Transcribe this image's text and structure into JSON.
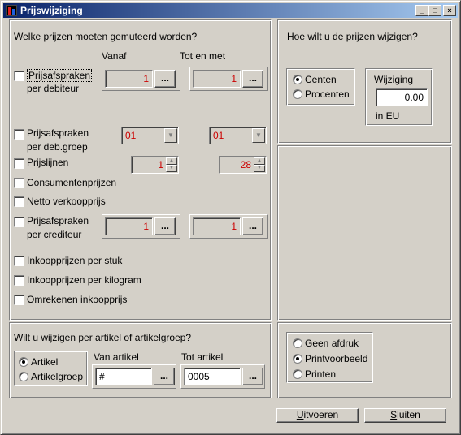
{
  "window": {
    "title": "Prijswijziging",
    "minimize_glyph": "_",
    "maximize_glyph": "□",
    "close_glyph": "×"
  },
  "prices_panel": {
    "heading": "Welke prijzen moeten gemuteerd worden?",
    "col_from": "Vanaf",
    "col_to": "Tot en met",
    "debtor_agreements": {
      "label_line1": "Prijsafspraken",
      "label_line2": "per debiteur",
      "checked": false,
      "from": "1",
      "to": "1",
      "lookup_glyph": "..."
    },
    "group_agreements": {
      "label_line1": "Prijsafspraken",
      "label_line2": "per deb.groep",
      "checked": false,
      "from": "01",
      "to": "01"
    },
    "price_lines": {
      "label": "Prijslijnen",
      "checked": false,
      "from": "1",
      "to": "28"
    },
    "consumer_prices": {
      "label": "Consumentenprijzen",
      "checked": false
    },
    "net_price": {
      "label": "Netto verkoopprijs",
      "checked": false
    },
    "creditor_agreements": {
      "label_line1": "Prijsafspraken",
      "label_line2": "per crediteur",
      "checked": false,
      "from": "1",
      "to": "1"
    },
    "purchase_per_piece": {
      "label": "Inkoopprijzen per stuk",
      "checked": false
    },
    "purchase_per_kg": {
      "label": "Inkoopprijzen per kilogram",
      "checked": false
    },
    "convert_purchase": {
      "label": "Omrekenen inkoopprijs",
      "checked": false
    }
  },
  "change_panel": {
    "heading": "Hoe wilt u de prijzen wijzigen?",
    "radio_cents": "Centen",
    "radio_percent": "Procenten",
    "selected": "Centen",
    "change_label": "Wijziging",
    "change_value": "0.00",
    "unit_label": "in EU"
  },
  "article_panel": {
    "heading": "Wilt u wijzigen per artikel of artikelgroep?",
    "radio_article": "Artikel",
    "radio_group": "Artikelgroep",
    "selected": "Artikel",
    "from_label": "Van artikel",
    "from_value": "#",
    "to_label": "Tot artikel",
    "to_value": "0005"
  },
  "print_panel": {
    "radio_none": "Geen afdruk",
    "radio_preview": "Printvoorbeeld",
    "radio_print": "Printen",
    "selected": "Printvoorbeeld"
  },
  "footer": {
    "execute_label_first": "U",
    "execute_label_rest": "itvoeren",
    "close_label_first": "S",
    "close_label_rest": "luiten"
  },
  "colors": {
    "title_bar": "#0a246a",
    "face": "#d4d0c8",
    "disabled_value": "#cc0000"
  }
}
